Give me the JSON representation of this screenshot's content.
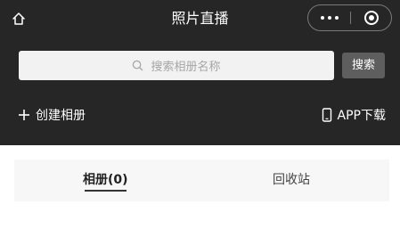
{
  "header": {
    "title": "照片直播",
    "home_icon": "home-icon",
    "more_icon": "more-dots-icon",
    "close_icon": "target-close-icon"
  },
  "search": {
    "placeholder": "搜索相册名称",
    "button_label": "搜索"
  },
  "actions": {
    "create_album_label": "创建相册",
    "app_download_label": "APP下载"
  },
  "tabs": [
    {
      "label": "相册(0)",
      "active": true
    },
    {
      "label": "回收站",
      "active": false
    }
  ],
  "colors": {
    "header_bg": "#262626",
    "search_bg": "#f2f2f2",
    "search_button_bg": "#5e5e5e",
    "tabs_bg": "#f7f7f7"
  }
}
